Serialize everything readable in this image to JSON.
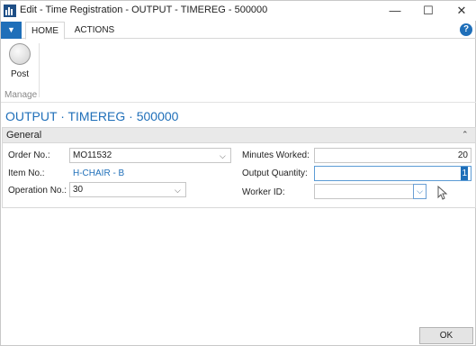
{
  "window": {
    "title": "Edit - Time Registration - OUTPUT - TIMEREG - 500000",
    "controls": {
      "minimize": "—",
      "maximize": "☐",
      "close": "✕"
    }
  },
  "ribbon": {
    "file_button": "▼",
    "tabs": [
      {
        "label": "HOME",
        "active": true
      },
      {
        "label": "ACTIONS",
        "active": false
      }
    ],
    "help": "?",
    "actions": [
      {
        "label": "Post",
        "icon": "post-icon"
      }
    ],
    "group_label": "Manage"
  },
  "page": {
    "title": "OUTPUT · TIMEREG · 500000"
  },
  "general": {
    "header": "General",
    "order_no_label": "Order No.:",
    "order_no": "MO11532",
    "item_no_label": "Item No.:",
    "item_no": "H-CHAIR - B",
    "operation_no_label": "Operation No.:",
    "operation_no": "30",
    "minutes_worked_label": "Minutes Worked:",
    "minutes_worked": "20",
    "output_quantity_label": "Output Quantity:",
    "output_quantity": "1",
    "worker_id_label": "Worker ID:",
    "worker_id": ""
  },
  "footer": {
    "ok_label": "OK"
  },
  "colors": {
    "accent": "#1f6fb9",
    "header_bg": "#e9e9e9"
  }
}
